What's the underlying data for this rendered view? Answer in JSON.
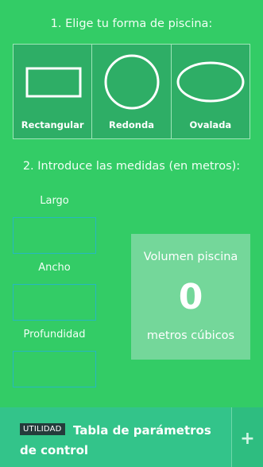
{
  "step1": {
    "title": "1. Elige tu forma de piscina:"
  },
  "shapes": [
    {
      "label": "Rectangular",
      "icon": "rectangle-icon"
    },
    {
      "label": "Redonda",
      "icon": "circle-icon"
    },
    {
      "label": "Ovalada",
      "icon": "oval-icon"
    }
  ],
  "step2": {
    "title": "2. Introduce las medidas (en metros):"
  },
  "fields": {
    "largo": {
      "label": "Largo",
      "value": ""
    },
    "ancho": {
      "label": "Ancho",
      "value": ""
    },
    "profundidad": {
      "label": "Profundidad",
      "value": ""
    }
  },
  "volume": {
    "title": "Volumen piscina",
    "value": "0",
    "unit": "metros cúbicos"
  },
  "bottom_bar": {
    "badge": "UTILIDAD",
    "title": "Tabla de parámetros de control",
    "plus": "+"
  },
  "colors": {
    "background": "#33cc66",
    "shape_tile": "#2eae66",
    "volume_panel": "#74d79a",
    "bottom_bar": "#33c48a",
    "badge": "#243b3b",
    "field_border": "#26b8c0"
  }
}
